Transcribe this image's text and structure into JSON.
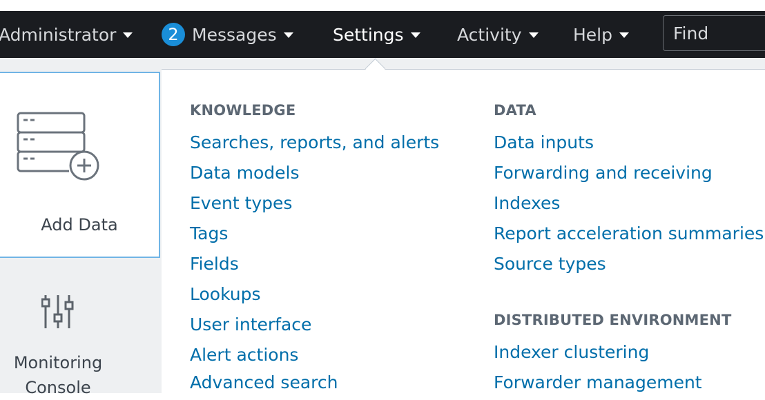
{
  "navbar": {
    "user_label": "Administrator",
    "messages_count": "2",
    "messages_label": "Messages",
    "settings_label": "Settings",
    "activity_label": "Activity",
    "help_label": "Help",
    "find_placeholder": "Find"
  },
  "launcher": {
    "add_data_label": "Add Data",
    "monitoring_label_1": "Monitoring",
    "monitoring_label_2": "Console"
  },
  "menu": {
    "knowledge": {
      "title": "KNOWLEDGE",
      "items": [
        "Searches, reports, and alerts",
        "Data models",
        "Event types",
        "Tags",
        "Fields",
        "Lookups",
        "User interface",
        "Alert actions",
        "Advanced search"
      ]
    },
    "data": {
      "title": "DATA",
      "items": [
        "Data inputs",
        "Forwarding and receiving",
        "Indexes",
        "Report acceleration summaries",
        "Source types"
      ]
    },
    "distributed": {
      "title": "DISTRIBUTED ENVIRONMENT",
      "items": [
        "Indexer clustering",
        "Forwarder management"
      ]
    }
  },
  "colors": {
    "navbar_bg": "#1a1c20",
    "link": "#006eaa",
    "badge": "#1a8ed8",
    "tile_border": "#70b4e5"
  }
}
